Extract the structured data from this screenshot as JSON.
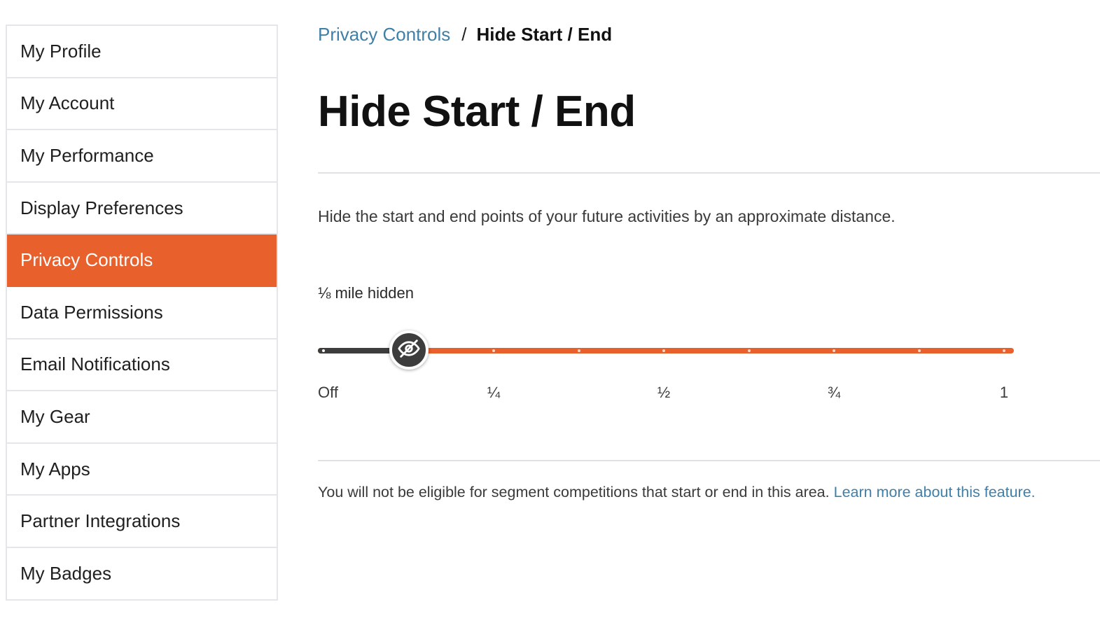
{
  "sidebar": {
    "items": [
      {
        "label": "My Profile"
      },
      {
        "label": "My Account"
      },
      {
        "label": "My Performance"
      },
      {
        "label": "Display Preferences"
      },
      {
        "label": "Privacy Controls",
        "active": true
      },
      {
        "label": "Data Permissions"
      },
      {
        "label": "Email Notifications"
      },
      {
        "label": "My Gear"
      },
      {
        "label": "My Apps"
      },
      {
        "label": "Partner Integrations"
      },
      {
        "label": "My Badges"
      }
    ]
  },
  "breadcrumb": {
    "parent": "Privacy Controls",
    "separator": "/",
    "current": "Hide Start / End"
  },
  "page": {
    "title": "Hide Start / End",
    "description": "Hide the start and end points of your future activities by an approximate distance."
  },
  "slider": {
    "value_label": "⅛ mile hidden",
    "value_miles": 0.125,
    "min_miles": 0,
    "max_miles": 1,
    "step_miles": 0.125,
    "thumb_icon": "eye-slash-icon",
    "tick_labels": [
      "Off",
      "¼",
      "½",
      "¾",
      "1"
    ]
  },
  "footer_note": {
    "text": "You will not be eligible for segment competitions that start or end in this area.",
    "link_text": "Learn more about this feature."
  },
  "colors": {
    "accent": "#e8602c",
    "link": "#3f7fa8",
    "track_fill": "#3d3d3d"
  }
}
